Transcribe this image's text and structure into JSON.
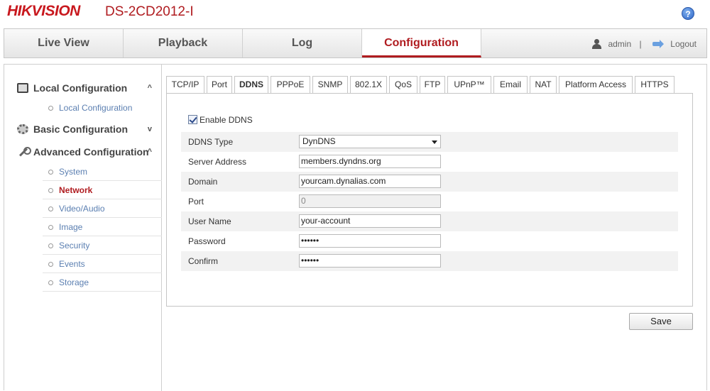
{
  "header": {
    "brand": "HIKVISION",
    "model": "DS-2CD2012-I",
    "help": "?"
  },
  "nav": {
    "tabs": [
      "Live View",
      "Playback",
      "Log",
      "Configuration"
    ],
    "active": "Configuration",
    "user": "admin",
    "separator": "|",
    "logout": "Logout"
  },
  "sidebar": {
    "local": {
      "label": "Local Configuration",
      "chev": "^",
      "items": [
        "Local Configuration"
      ]
    },
    "basic": {
      "label": "Basic Configuration",
      "chev": "v"
    },
    "advanced": {
      "label": "Advanced Configuration",
      "chev": "^",
      "items": [
        "System",
        "Network",
        "Video/Audio",
        "Image",
        "Security",
        "Events",
        "Storage"
      ],
      "active": "Network"
    }
  },
  "subtabs": [
    "TCP/IP",
    "Port",
    "DDNS",
    "PPPoE",
    "SNMP",
    "802.1X",
    "QoS",
    "FTP",
    "UPnP™",
    "Email",
    "NAT",
    "Platform Access",
    "HTTPS"
  ],
  "active_subtab": "DDNS",
  "form": {
    "enable_label": "Enable DDNS",
    "enabled": true,
    "ddns_type_label": "DDNS Type",
    "ddns_type_value": "DynDNS",
    "server_label": "Server Address",
    "server_value": "members.dyndns.org",
    "domain_label": "Domain",
    "domain_value": "yourcam.dynalias.com",
    "port_label": "Port",
    "port_value": "0",
    "username_label": "User Name",
    "username_value": "your-account",
    "password_label": "Password",
    "password_value": "••••••",
    "confirm_label": "Confirm",
    "confirm_value": "••••••"
  },
  "save_label": "Save"
}
